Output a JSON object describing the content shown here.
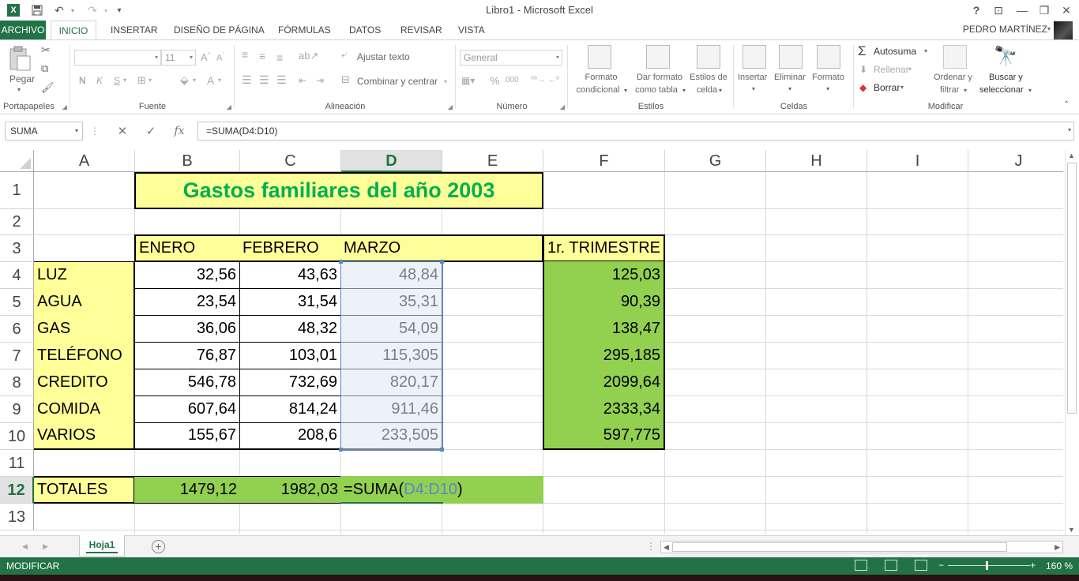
{
  "window": {
    "title": "Libro1 - Microsoft Excel",
    "help": "?",
    "restore_ribbon": "⊡",
    "minimize": "—",
    "maximize": "❐",
    "close": "✕"
  },
  "quick_access": {
    "save": "💾",
    "undo": "↶",
    "redo": "↷",
    "customize": "▾"
  },
  "ribbon_tabs": [
    "ARCHIVO",
    "INICIO",
    "INSERTAR",
    "DISEÑO DE PÁGINA",
    "FÓRMULAS",
    "DATOS",
    "REVISAR",
    "VISTA"
  ],
  "active_tab": "INICIO",
  "user": "PEDRO MARTÍNEZ",
  "ribbon": {
    "clipboard": {
      "label": "Portapapeles",
      "paste": "Pegar"
    },
    "font": {
      "label": "Fuente",
      "font_name": "",
      "font_size": "11",
      "bold": "N",
      "italic": "K",
      "underline": "S"
    },
    "alignment": {
      "label": "Alineación",
      "wrap": "Ajustar texto",
      "merge": "Combinar y centrar"
    },
    "number": {
      "label": "Número",
      "format": "General",
      "percent": "%",
      "thousands": "000"
    },
    "styles": {
      "label": "Estilos",
      "conditional": [
        "Formato",
        "condicional"
      ],
      "as_table": [
        "Dar formato",
        "como tabla"
      ],
      "cell_styles": [
        "Estilos de",
        "celda"
      ]
    },
    "cells": {
      "label": "Celdas",
      "insert": "Insertar",
      "delete": "Eliminar",
      "format": "Formato"
    },
    "editing": {
      "label": "Modificar",
      "autosum": "Autosuma",
      "fill": "Rellenar",
      "clear": "Borrar",
      "sort": [
        "Ordenar y",
        "filtrar"
      ],
      "find": [
        "Buscar y",
        "seleccionar"
      ]
    }
  },
  "formula_bar": {
    "name_box": "SUMA",
    "fx": "fx",
    "cancel": "✕",
    "enter": "✓",
    "formula": "=SUMA(D4:D10)"
  },
  "columns": [
    "A",
    "B",
    "C",
    "D",
    "E",
    "F",
    "G",
    "H",
    "I",
    "J"
  ],
  "selected_column": "D",
  "rows": [
    "1",
    "2",
    "3",
    "4",
    "5",
    "6",
    "7",
    "8",
    "9",
    "10",
    "11",
    "12",
    "13"
  ],
  "selected_row": "12",
  "sheet": {
    "title": "Gastos familiares del año 2003",
    "headers": {
      "B3": "ENERO",
      "C3": "FEBRERO",
      "D3": "MARZO",
      "F3": "1r. TRIMESTRE"
    },
    "data_rows": [
      {
        "label": "LUZ",
        "b": "32,56",
        "c": "43,63",
        "d": "48,84",
        "f": "125,03"
      },
      {
        "label": "AGUA",
        "b": "23,54",
        "c": "31,54",
        "d": "35,31",
        "f": "90,39"
      },
      {
        "label": "GAS",
        "b": "36,06",
        "c": "48,32",
        "d": "54,09",
        "f": "138,47"
      },
      {
        "label": "TELÉFONO",
        "b": "76,87",
        "c": "103,01",
        "d": "115,305",
        "f": "295,185"
      },
      {
        "label": "CREDITO",
        "b": "546,78",
        "c": "732,69",
        "d": "820,17",
        "f": "2099,64"
      },
      {
        "label": "COMIDA",
        "b": "607,64",
        "c": "814,24",
        "d": "911,46",
        "f": "2333,34"
      },
      {
        "label": "VARIOS",
        "b": "155,67",
        "c": "208,6",
        "d": "233,505",
        "f": "597,775"
      }
    ],
    "totals": {
      "label": "TOTALES",
      "b": "1479,12",
      "c": "1982,03",
      "d_prefix": "=SUMA(",
      "d_ref": "D4:D10",
      "d_suffix": ")"
    }
  },
  "sheet_tabs": [
    "Hoja1"
  ],
  "add_sheet": "+",
  "status": {
    "mode": "MODIFICAR",
    "zoom": "160 %"
  },
  "colors": {
    "excel_green": "#217346",
    "header_yellow": "#ffff99",
    "total_green": "#92d050",
    "title_green": "#00b050",
    "ref_blue": "#5b87c7"
  }
}
